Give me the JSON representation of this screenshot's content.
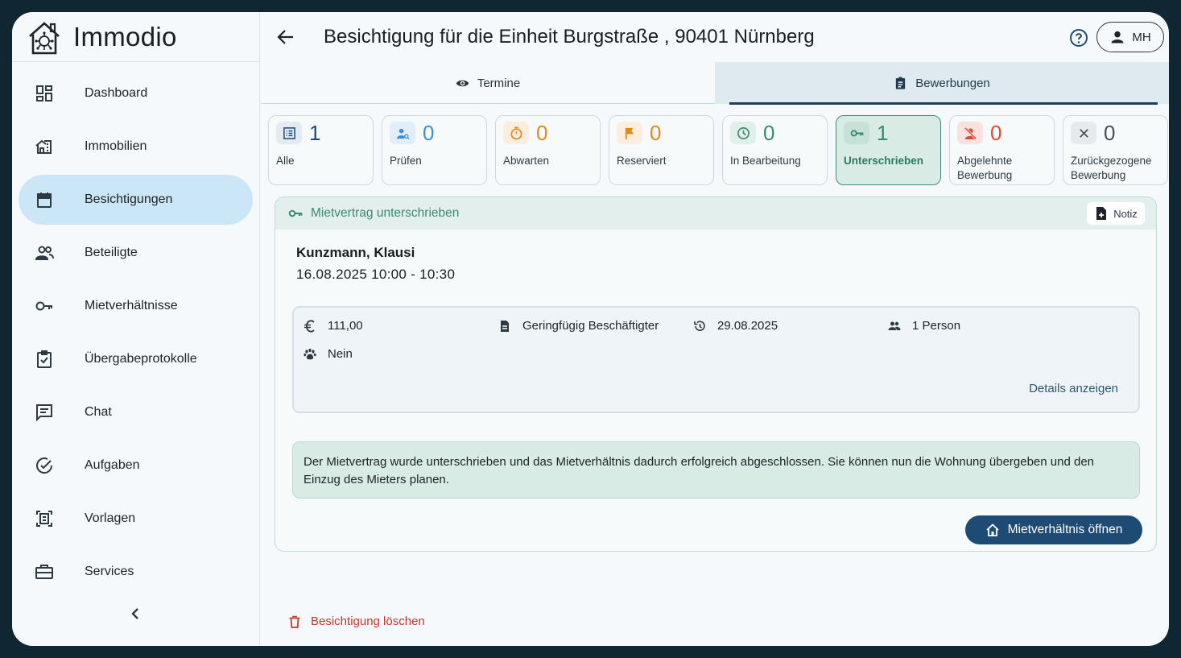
{
  "app": {
    "name": "Immodio"
  },
  "sidebar": {
    "items": [
      {
        "label": "Dashboard",
        "icon": "dashboard-icon"
      },
      {
        "label": "Immobilien",
        "icon": "building-icon"
      },
      {
        "label": "Besichtigungen",
        "icon": "calendar-icon",
        "active": true
      },
      {
        "label": "Beteiligte",
        "icon": "people-icon"
      },
      {
        "label": "Mietverhältnisse",
        "icon": "key-icon"
      },
      {
        "label": "Übergabeprotokolle",
        "icon": "clipboard-check-icon"
      },
      {
        "label": "Chat",
        "icon": "chat-icon"
      },
      {
        "label": "Aufgaben",
        "icon": "check-circle-icon"
      },
      {
        "label": "Vorlagen",
        "icon": "template-icon"
      },
      {
        "label": "Services",
        "icon": "briefcase-icon"
      }
    ]
  },
  "header": {
    "title": "Besichtigung für die Einheit Burgstraße , 90401 Nürnberg",
    "user_initials": "MH"
  },
  "tabs": [
    {
      "label": "Termine",
      "icon": "eye-icon"
    },
    {
      "label": "Bewerbungen",
      "icon": "clipboard-icon",
      "active": true
    }
  ],
  "status_cards": [
    {
      "count": "1",
      "label": "Alle",
      "icon": "list-icon",
      "color": "#1e4b73",
      "bg": "#e3ebf1"
    },
    {
      "count": "0",
      "label": "Prüfen",
      "icon": "person-search-icon",
      "color": "#3b8fd6",
      "bg": "#e1eef9"
    },
    {
      "count": "0",
      "label": "Abwarten",
      "icon": "timer-icon",
      "color": "#e08a1e",
      "bg": "#fbeede"
    },
    {
      "count": "0",
      "label": "Reserviert",
      "icon": "flag-icon",
      "color": "#e08a1e",
      "bg": "#fbeede"
    },
    {
      "count": "0",
      "label": "In Bearbeitung",
      "icon": "clock-icon",
      "color": "#3a8a73",
      "bg": "#e0efe9"
    },
    {
      "count": "1",
      "label": "Unterschrieben",
      "icon": "key-icon",
      "color": "#3a8a73",
      "bg": "#c6e2d8",
      "active": true
    },
    {
      "count": "0",
      "label": "Abgelehnte Bewerbung",
      "icon": "person-off-icon",
      "color": "#d94a3a",
      "bg": "#f9e1de"
    },
    {
      "count": "0",
      "label": "Zurückgezogene Bewerbung",
      "icon": "close-icon",
      "color": "#4a5358",
      "bg": "#e6eaec"
    }
  ],
  "contract": {
    "header": "Mietvertrag unterschrieben",
    "note_label": "Notiz",
    "tenant": "Kunzmann, Klausi",
    "time": "16.08.2025 10:00 - 10:30",
    "facts": {
      "rent": "111,00",
      "employment": "Geringfügig Beschäftigter",
      "date": "29.08.2025",
      "persons": "1 Person",
      "pets": "Nein"
    },
    "details_label": "Details anzeigen",
    "notice": "Der Mietvertrag wurde unterschrieben und das Mietverhältnis dadurch erfolgreich abgeschlossen. Sie können nun die Wohnung übergeben und den Einzug des Mieters planen.",
    "open_label": "Mietverhältnis öffnen"
  },
  "delete_label": "Besichtigung löschen"
}
